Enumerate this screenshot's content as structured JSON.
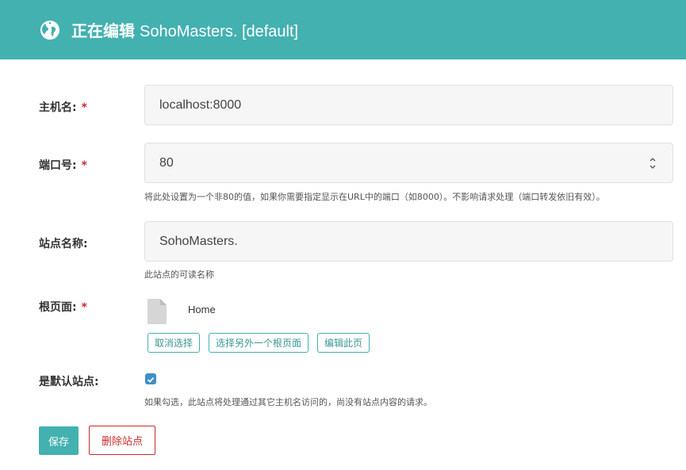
{
  "header": {
    "verb": "正在编辑",
    "site": "SohoMasters. [default]",
    "icon": "globe-icon",
    "background": "#43b1b0"
  },
  "fields": {
    "hostname": {
      "label": "主机名:",
      "required": "*",
      "value": "localhost:8000"
    },
    "port": {
      "label": "端口号:",
      "required": "*",
      "value": "80",
      "help": "将此处设置为一个非80的值，如果你需要指定显示在URL中的端口（如8000）。不影响请求处理（端口转发依旧有效）。"
    },
    "site_name": {
      "label": "站点名称:",
      "value": "SohoMasters.",
      "help": "此站点的可读名称"
    },
    "root_page": {
      "label": "根页面:",
      "required": "*",
      "page_title": "Home",
      "buttons": {
        "clear": "取消选择",
        "choose_another": "选择另外一个根页面",
        "edit": "编辑此页"
      }
    },
    "is_default": {
      "label": "是默认站点:",
      "checked": true,
      "help": "如果勾选，此站点将处理通过其它主机名访问的，尚没有站点内容的请求。"
    }
  },
  "actions": {
    "save": "保存",
    "delete": "删除站点"
  },
  "colors": {
    "accent": "#43b1b0",
    "danger": "#cd2a2a",
    "checkbox": "#3d8ec9"
  }
}
